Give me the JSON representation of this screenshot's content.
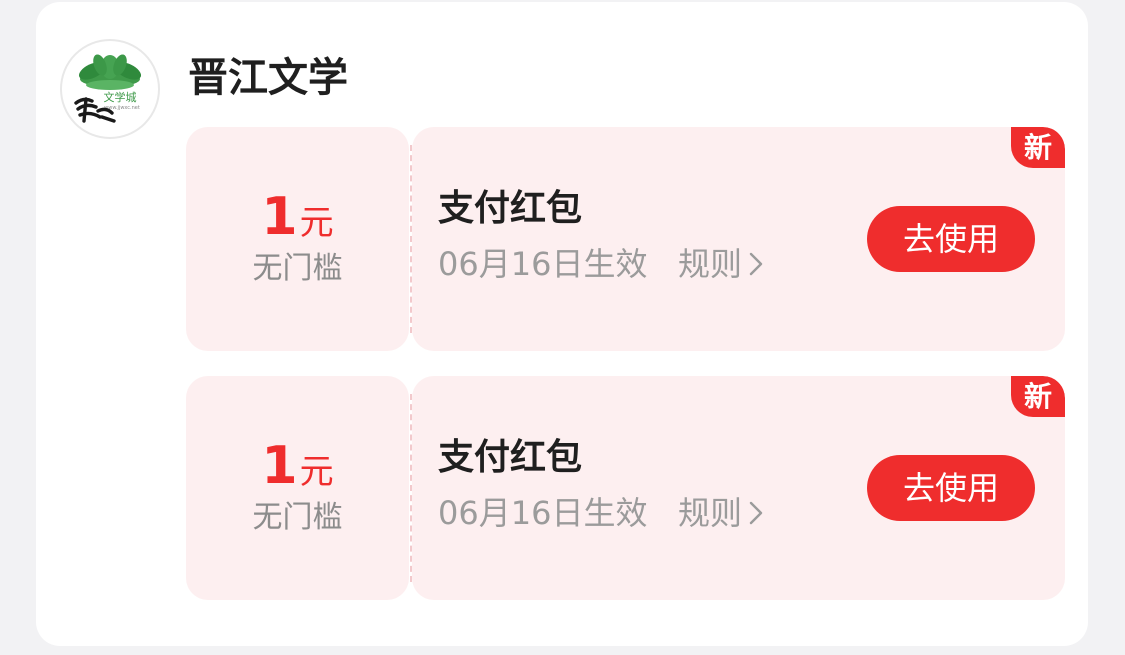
{
  "merchant": {
    "name": "晋江文学",
    "logo": {
      "icon": "jinjiang-logo",
      "text_cn": "文学城",
      "text_url": "www.jjwxc.net"
    }
  },
  "coupons": [
    {
      "amount": "1",
      "unit": "元",
      "threshold": "无门槛",
      "title": "支付红包",
      "effective": "06月16日生效",
      "rules_label": "规则",
      "button_label": "去使用",
      "badge": "新"
    },
    {
      "amount": "1",
      "unit": "元",
      "threshold": "无门槛",
      "title": "支付红包",
      "effective": "06月16日生效",
      "rules_label": "规则",
      "button_label": "去使用",
      "badge": "新"
    }
  ],
  "colors": {
    "accent_red": "#ef2d2d",
    "coupon_bg": "#fdeff0",
    "muted_text": "#9b9b9b"
  }
}
